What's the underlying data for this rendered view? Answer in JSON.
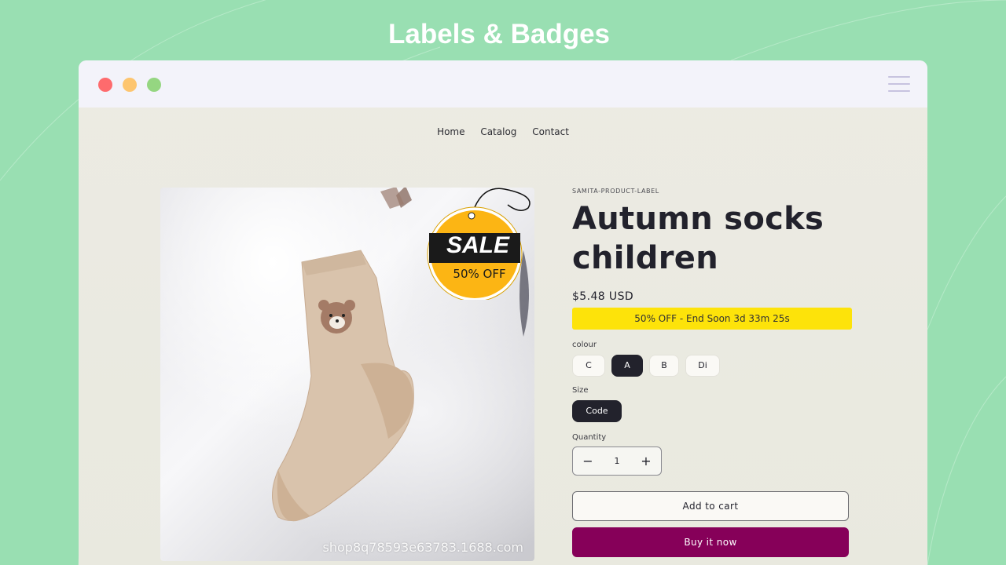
{
  "headline": "Labels & Badges",
  "nav": {
    "items": [
      "Home",
      "Catalog",
      "Contact"
    ]
  },
  "product": {
    "vendor": "SAMITA-PRODUCT-LABEL",
    "title": "Autumn socks children",
    "price": "$5.48 USD",
    "countdown": "50% OFF - End Soon 3d 33m 25s",
    "image_watermark": "shop8q78593e63783.1688.com",
    "badge": {
      "title": "SALE",
      "subtitle": "50% OFF"
    },
    "colour": {
      "label": "colour",
      "options": [
        "C",
        "A",
        "B",
        "Di"
      ],
      "selected": "A"
    },
    "size": {
      "label": "Size",
      "options": [
        "Code"
      ],
      "selected": "Code"
    },
    "quantity": {
      "label": "Quantity",
      "value": "1",
      "minus": "−",
      "plus": "+"
    },
    "add_to_cart": "Add to cart",
    "buy_now": "Buy it now"
  },
  "colors": {
    "background": "#99dfb2",
    "countdown_bar": "#fde30a",
    "buy_now": "#860059",
    "badge_yellow": "#fcb514"
  }
}
